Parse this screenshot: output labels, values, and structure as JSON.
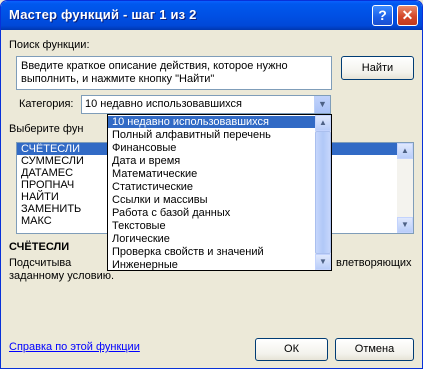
{
  "window": {
    "title": "Мастер функций - шаг 1 из 2",
    "help_glyph": "?",
    "close_glyph": "✕"
  },
  "search": {
    "label": "Поиск функции:",
    "text": "Введите краткое описание действия, которое нужно выполнить, и нажмите кнопку \"Найти\"",
    "find_button": "Найти"
  },
  "category": {
    "label": "Категория:",
    "selected": "10 недавно использовавшихся",
    "options": [
      "10 недавно использовавшихся",
      "Полный алфавитный перечень",
      "Финансовые",
      "Дата и время",
      "Математические",
      "Статистические",
      "Ссылки и массивы",
      "Работа с базой данных",
      "Текстовые",
      "Логические",
      "Проверка свойств и значений",
      "Инженерные"
    ]
  },
  "functions": {
    "label": "Выберите фун",
    "items": [
      "СЧЁТЕСЛИ",
      "СУММЕСЛИ",
      "ДАТАМЕС",
      "ПРОПНАЧ",
      "НАЙТИ",
      "ЗАМЕНИТЬ",
      "МАКС"
    ]
  },
  "syntax": "СЧЁТЕСЛИ",
  "description": {
    "start": "Подсчитыва",
    "end": "влетворяющих",
    "line2": "заданному условию."
  },
  "footer": {
    "help_link": "Справка по этой функции",
    "ok": "ОК",
    "cancel": "Отмена"
  },
  "colors": {
    "title_bar": "#0054e3",
    "selection": "#316ac5",
    "link": "#0000ff"
  }
}
